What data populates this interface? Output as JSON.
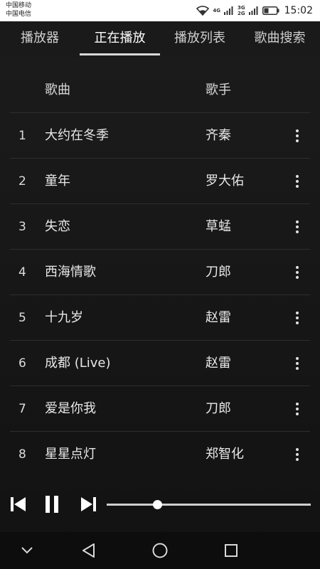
{
  "status": {
    "carrier_1": "中国移动",
    "carrier_2": "中国电信",
    "net_tag_1": "4G",
    "net_tag_2": "3G",
    "net_tag_3": "2G",
    "time": "15:02"
  },
  "tabs": [
    {
      "label": "播放器",
      "active": false
    },
    {
      "label": "正在播放",
      "active": true
    },
    {
      "label": "播放列表",
      "active": false
    },
    {
      "label": "歌曲搜索",
      "active": false
    }
  ],
  "list_header": {
    "song": "歌曲",
    "artist": "歌手"
  },
  "songs": [
    {
      "index": "1",
      "title": "大约在冬季",
      "artist": "齐秦"
    },
    {
      "index": "2",
      "title": "童年",
      "artist": "罗大佑"
    },
    {
      "index": "3",
      "title": "失恋",
      "artist": "草蜢"
    },
    {
      "index": "4",
      "title": "西海情歌",
      "artist": "刀郎"
    },
    {
      "index": "5",
      "title": "十九岁",
      "artist": "赵雷"
    },
    {
      "index": "6",
      "title": "成都 (Live)",
      "artist": "赵雷"
    },
    {
      "index": "7",
      "title": "爱是你我",
      "artist": "刀郎"
    },
    {
      "index": "8",
      "title": "星星点灯",
      "artist": "郑智化"
    }
  ],
  "player": {
    "progress_fraction": 0.25
  },
  "icons": {
    "previous": "skip-previous-icon",
    "pause": "pause-icon",
    "next": "skip-next-icon",
    "more": "more-vertical-icon",
    "nav_collapse": "chevron-down-icon",
    "nav_back": "triangle-back-icon",
    "nav_home": "circle-home-icon",
    "nav_recents": "square-recents-icon"
  },
  "colors": {
    "background": "#161616",
    "text": "#e6e6e6",
    "accent": "#ffffff"
  }
}
